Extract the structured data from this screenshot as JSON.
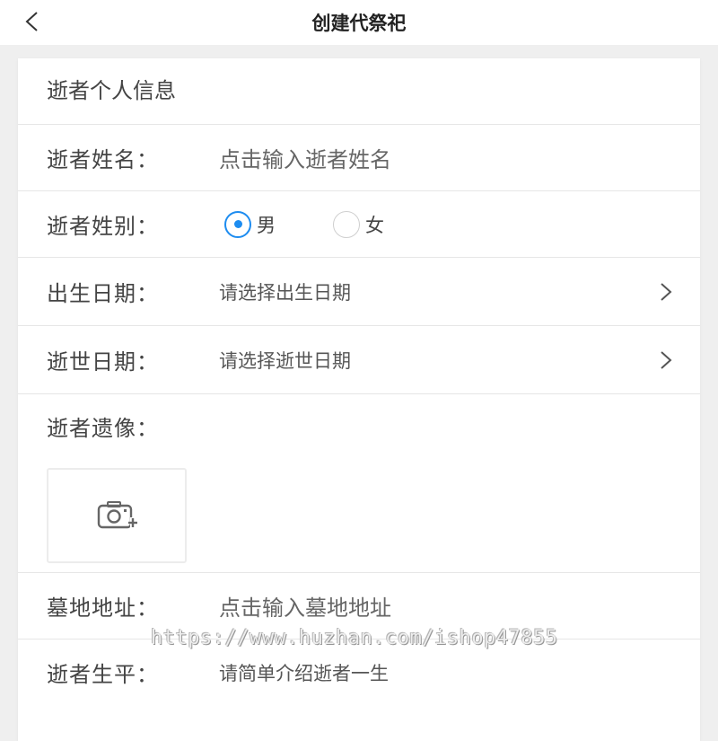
{
  "nav": {
    "title": "创建代祭祀",
    "back_icon": "chevron-left-icon"
  },
  "form": {
    "section_title": "逝者个人信息",
    "name": {
      "label": "逝者姓名：",
      "placeholder": "点击输入逝者姓名"
    },
    "gender": {
      "label": "逝者姓别：",
      "options": [
        "男",
        "女"
      ],
      "selected": "男"
    },
    "birth_date": {
      "label": "出生日期：",
      "placeholder": "请选择出生日期",
      "icon": "chevron-right-icon"
    },
    "death_date": {
      "label": "逝世日期：",
      "placeholder": "请选择逝世日期",
      "icon": "chevron-right-icon"
    },
    "portrait": {
      "label": "逝者遗像：",
      "icon": "camera-add-icon"
    },
    "cemetery": {
      "label": "墓地地址：",
      "placeholder": "点击输入墓地地址"
    },
    "biography": {
      "label": "逝者生平：",
      "placeholder": "请简单介绍逝者一生"
    }
  },
  "colors": {
    "accent": "#1d8cf0",
    "background": "#efefef",
    "card": "#ffffff"
  },
  "watermark": "https://www.huzhan.com/ishop47855"
}
